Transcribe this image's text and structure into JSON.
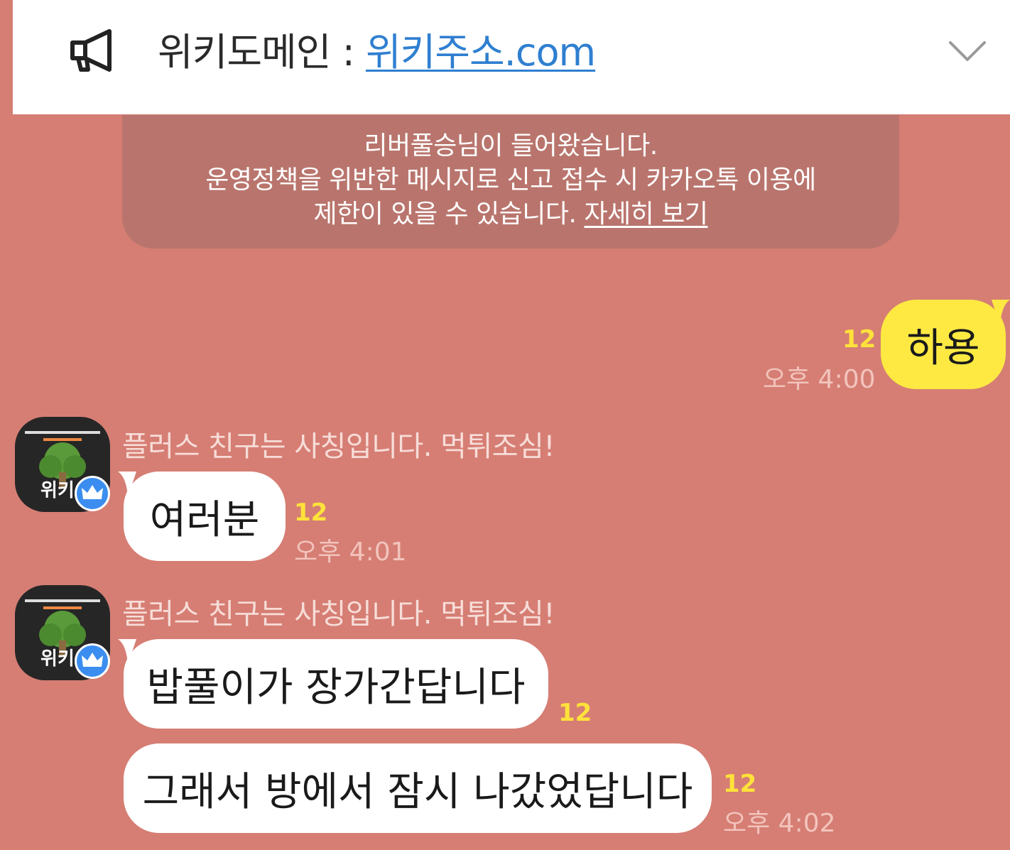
{
  "notice": {
    "prefix": "위키도메인 : ",
    "link": "위키주소.com"
  },
  "system_message": {
    "line1": "리버풀승님이 들어왔습니다.",
    "line2": "운영정책을 위반한 메시지로 신고 접수 시 카카오톡 이용에",
    "line3_prefix": "제한이 있을 수 있습니다. ",
    "detail_link": "자세히 보기"
  },
  "messages": [
    {
      "text": "하용",
      "unread": "12",
      "time": "오후 4:00"
    },
    {
      "sender": "플러스 친구는 사칭입니다. 먹튀조심!",
      "text": "여러분",
      "unread": "12",
      "time": "오후 4:01"
    },
    {
      "sender": "플러스 친구는 사칭입니다. 먹튀조심!",
      "text": "밥풀이가 장가간답니다",
      "unread": "12"
    },
    {
      "text": "그래서 방에서 잠시 나갔었답니다",
      "unread": "12",
      "time": "오후 4:02"
    }
  ],
  "avatar": {
    "label": "위키",
    "icon": "tree-icon",
    "badge": "crown-icon"
  },
  "colors": {
    "background": "#d67e74",
    "my_bubble": "#fee943",
    "other_bubble": "#ffffff",
    "unread": "#ffe23a",
    "link": "#2f7fd0"
  }
}
